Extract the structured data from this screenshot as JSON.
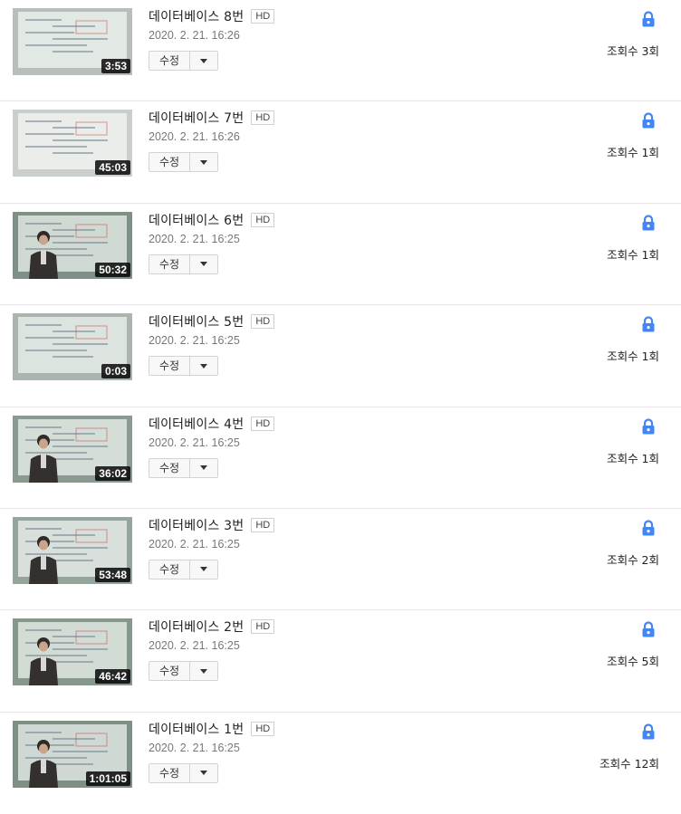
{
  "videos": [
    {
      "title": "데이터베이스 8번",
      "hd": "HD",
      "date": "2020. 2. 21. 16:26",
      "duration": "3:53",
      "edit_label": "수정",
      "views": "조회수 3회",
      "privacy_icon": "lock-icon",
      "thumb": {
        "bg": "#b8bfba",
        "person": false,
        "screen": "#e7ece9"
      }
    },
    {
      "title": "데이터베이스 7번",
      "hd": "HD",
      "date": "2020. 2. 21. 16:26",
      "duration": "45:03",
      "edit_label": "수정",
      "views": "조회수 1회",
      "privacy_icon": "lock-icon",
      "thumb": {
        "bg": "#c9d0cb",
        "person": false,
        "screen": "#eef0ee"
      }
    },
    {
      "title": "데이터베이스 6번",
      "hd": "HD",
      "date": "2020. 2. 21. 16:25",
      "duration": "50:32",
      "edit_label": "수정",
      "views": "조회수 1회",
      "privacy_icon": "lock-icon",
      "thumb": {
        "bg": "#7f9186",
        "person": true,
        "screen": "#d9e2dc"
      }
    },
    {
      "title": "데이터베이스 5번",
      "hd": "HD",
      "date": "2020. 2. 21. 16:25",
      "duration": "0:03",
      "edit_label": "수정",
      "views": "조회수 1회",
      "privacy_icon": "lock-icon",
      "thumb": {
        "bg": "#a9b5ad",
        "person": false,
        "screen": "#e2e8e4"
      }
    },
    {
      "title": "데이터베이스 4번",
      "hd": "HD",
      "date": "2020. 2. 21. 16:25",
      "duration": "36:02",
      "edit_label": "수정",
      "views": "조회수 1회",
      "privacy_icon": "lock-icon",
      "thumb": {
        "bg": "#8a9a90",
        "person": true,
        "screen": "#dde4df"
      }
    },
    {
      "title": "데이터베이스 3번",
      "hd": "HD",
      "date": "2020. 2. 21. 16:25",
      "duration": "53:48",
      "edit_label": "수정",
      "views": "조회수 2회",
      "privacy_icon": "lock-icon",
      "thumb": {
        "bg": "#94a69b",
        "person": true,
        "screen": "#e0e6e2"
      }
    },
    {
      "title": "데이터베이스 2번",
      "hd": "HD",
      "date": "2020. 2. 21. 16:25",
      "duration": "46:42",
      "edit_label": "수정",
      "views": "조회수 5회",
      "privacy_icon": "lock-icon",
      "thumb": {
        "bg": "#86978c",
        "person": true,
        "screen": "#dbe2dd"
      }
    },
    {
      "title": "데이터베이스 1번",
      "hd": "HD",
      "date": "2020. 2. 21. 16:25",
      "duration": "1:01:05",
      "edit_label": "수정",
      "views": "조회수 12회",
      "privacy_icon": "lock-icon",
      "thumb": {
        "bg": "#7e9084",
        "person": true,
        "screen": "#d8e0da"
      }
    }
  ],
  "colors": {
    "lock": "#4285f4",
    "border": "#e6e6e6"
  }
}
